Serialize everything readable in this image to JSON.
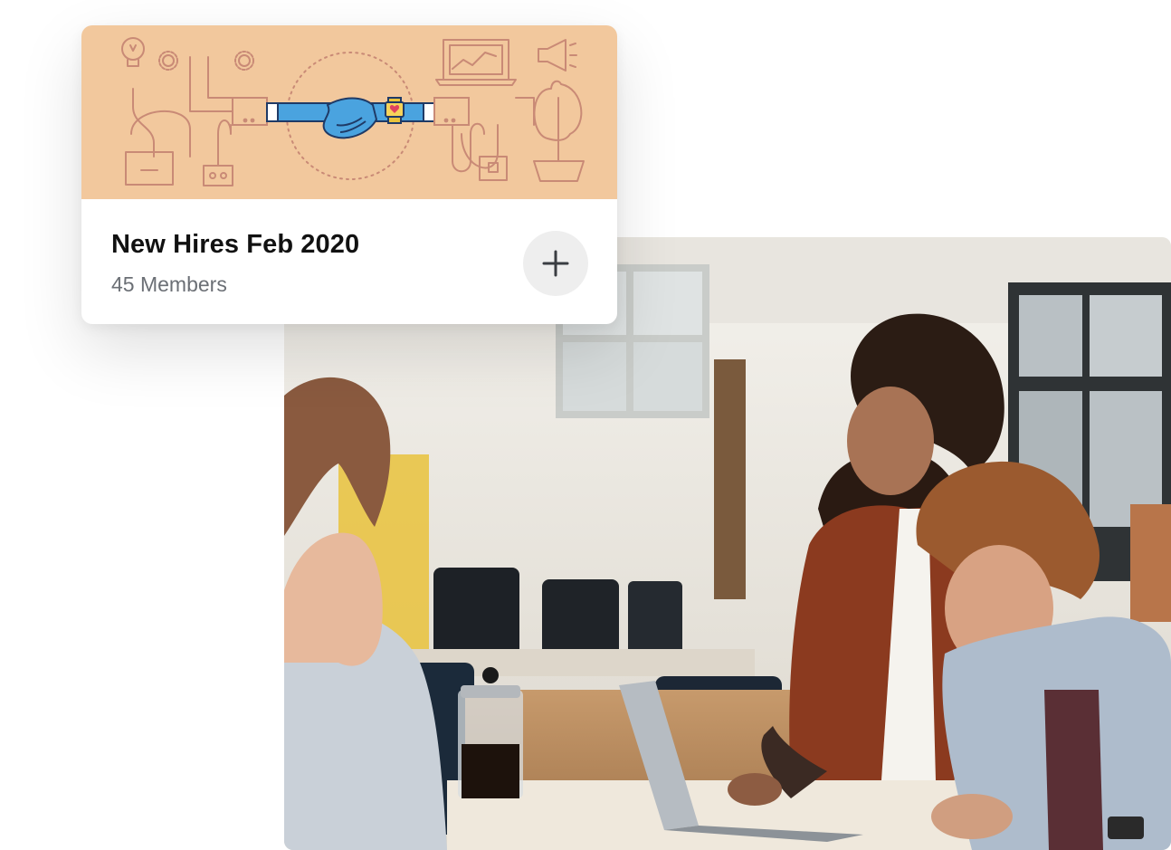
{
  "group_card": {
    "title": "New Hires Feb 2020",
    "subtitle": "45 Members",
    "banner_color": "#f2c89d",
    "add_button_icon": "plus-icon"
  },
  "banner_illustration": {
    "line_color": "#c98a76",
    "handshake_color": "#4aa3df",
    "icons": [
      "lightbulb-icon",
      "gear-icon",
      "laptop-chart-icon",
      "megaphone-icon",
      "handshake-icon",
      "heart-icon",
      "plant-icon",
      "mailbox-icon",
      "plug-icon"
    ]
  },
  "photo": {
    "subject": "office-meeting-photo"
  }
}
